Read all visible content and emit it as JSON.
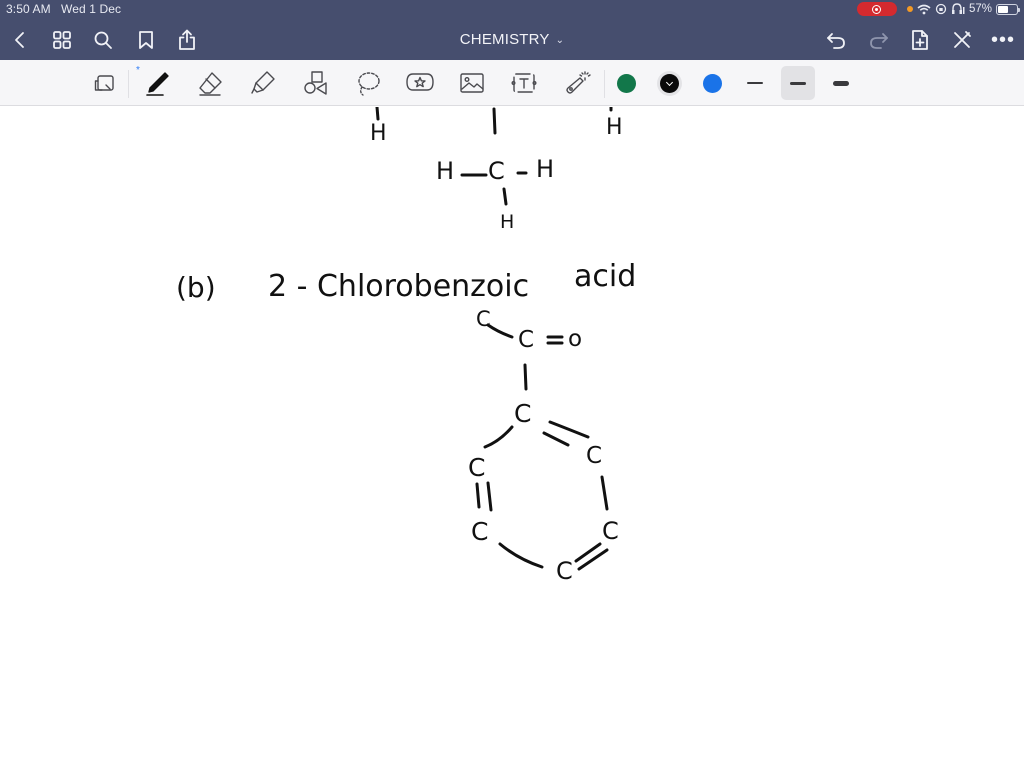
{
  "status_bar": {
    "time": "3:50 AM",
    "date": "Wed 1 Dec",
    "battery_percent": "57%",
    "battery_level": 0.57,
    "icons": [
      "screen-recording-icon",
      "orange-dot-icon",
      "wifi-icon",
      "orientation-lock-icon",
      "headphones-icon",
      "battery-icon"
    ]
  },
  "header": {
    "title": "CHEMISTRY",
    "title_chevron": "⌄",
    "left_buttons": [
      "back-icon",
      "grid-icon",
      "search-icon",
      "bookmark-icon",
      "share-icon"
    ],
    "right_buttons": [
      "undo-icon",
      "redo-icon",
      "add-page-icon",
      "close-edit-icon",
      "more-icon"
    ],
    "more_label": "•••"
  },
  "toolbar": {
    "tools": [
      "read-mode-icon",
      "pen-icon",
      "eraser-icon",
      "highlighter-icon",
      "shapes-icon",
      "lasso-icon",
      "sticker-icon",
      "image-icon",
      "text-box-icon",
      "laser-pointer-icon"
    ],
    "bluetooth_mark": "*",
    "colors": [
      {
        "name": "green",
        "hex": "#12774a",
        "selected": false
      },
      {
        "name": "black",
        "hex": "#0a0a0a",
        "selected": true
      },
      {
        "name": "blue",
        "hex": "#1a73e8",
        "selected": false
      }
    ],
    "stroke_widths": [
      {
        "name": "thin",
        "selected": false
      },
      {
        "name": "medium",
        "selected": true
      },
      {
        "name": "thick",
        "selected": false
      }
    ]
  },
  "canvas": {
    "top_fragment": {
      "left_h": "H",
      "right_h": "H",
      "methyl": {
        "left": "H",
        "bond_left": "—",
        "center": "C",
        "bond_right": "-",
        "right": "H",
        "bottom": "H"
      }
    },
    "part_b": {
      "label": "(b)",
      "name": "2 - Chlorobenzoic",
      "suffix": "acid"
    },
    "structure": {
      "carboxyl": {
        "c_left": "C",
        "c_center": "C",
        "double_bond": "=",
        "oxygen": "o"
      },
      "ring": {
        "top": "C",
        "upper_right": "C",
        "upper_left": "C",
        "lower_left": "C",
        "lower_right": "C",
        "bottom": "C"
      }
    }
  }
}
